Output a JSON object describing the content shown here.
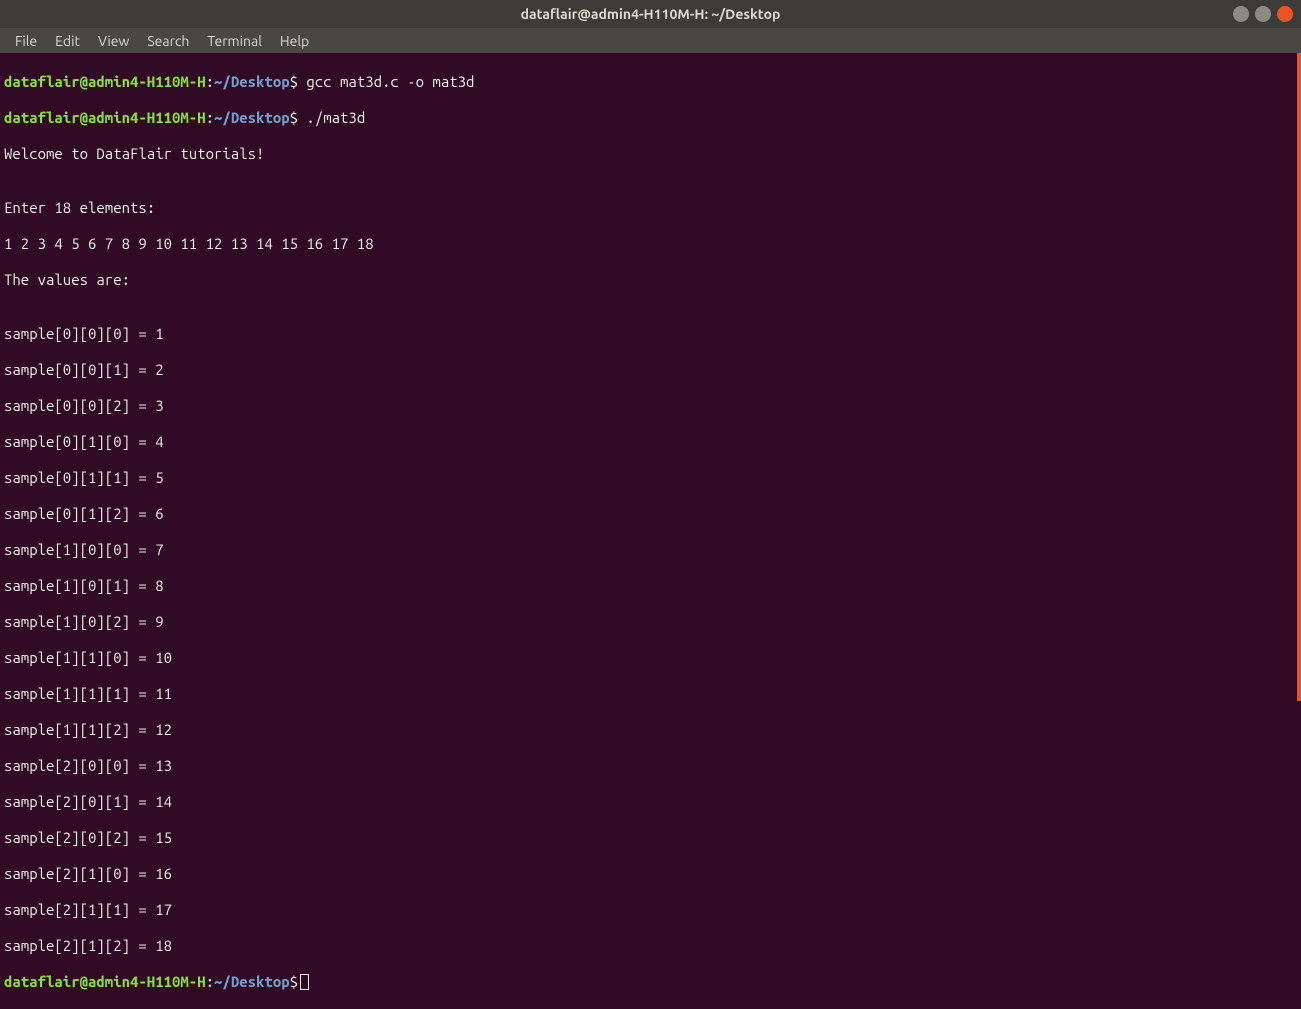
{
  "titlebar": {
    "title": "dataflair@admin4-H110M-H: ~/Desktop"
  },
  "menubar": {
    "items": [
      "File",
      "Edit",
      "View",
      "Search",
      "Terminal",
      "Help"
    ]
  },
  "prompt": {
    "user_host": "dataflair@admin4-H110M-H",
    "separator": ":",
    "path": "~/Desktop",
    "sigil": "$"
  },
  "commands": {
    "line1": " gcc mat3d.c -o mat3d",
    "line2": " ./mat3d"
  },
  "output": {
    "welcome": "Welcome to DataFlair tutorials!",
    "blank1": "",
    "enter_prompt": "Enter 18 elements:",
    "input_values": "1 2 3 4 5 6 7 8 9 10 11 12 13 14 15 16 17 18",
    "values_header": "The values are:",
    "blank2": "",
    "samples": [
      "sample[0][0][0] = 1",
      "sample[0][0][1] = 2",
      "sample[0][0][2] = 3",
      "sample[0][1][0] = 4",
      "sample[0][1][1] = 5",
      "sample[0][1][2] = 6",
      "sample[1][0][0] = 7",
      "sample[1][0][1] = 8",
      "sample[1][0][2] = 9",
      "sample[1][1][0] = 10",
      "sample[1][1][1] = 11",
      "sample[1][1][2] = 12",
      "sample[2][0][0] = 13",
      "sample[2][0][1] = 14",
      "sample[2][0][2] = 15",
      "sample[2][1][0] = 16",
      "sample[2][1][1] = 17",
      "sample[2][1][2] = 18"
    ]
  }
}
